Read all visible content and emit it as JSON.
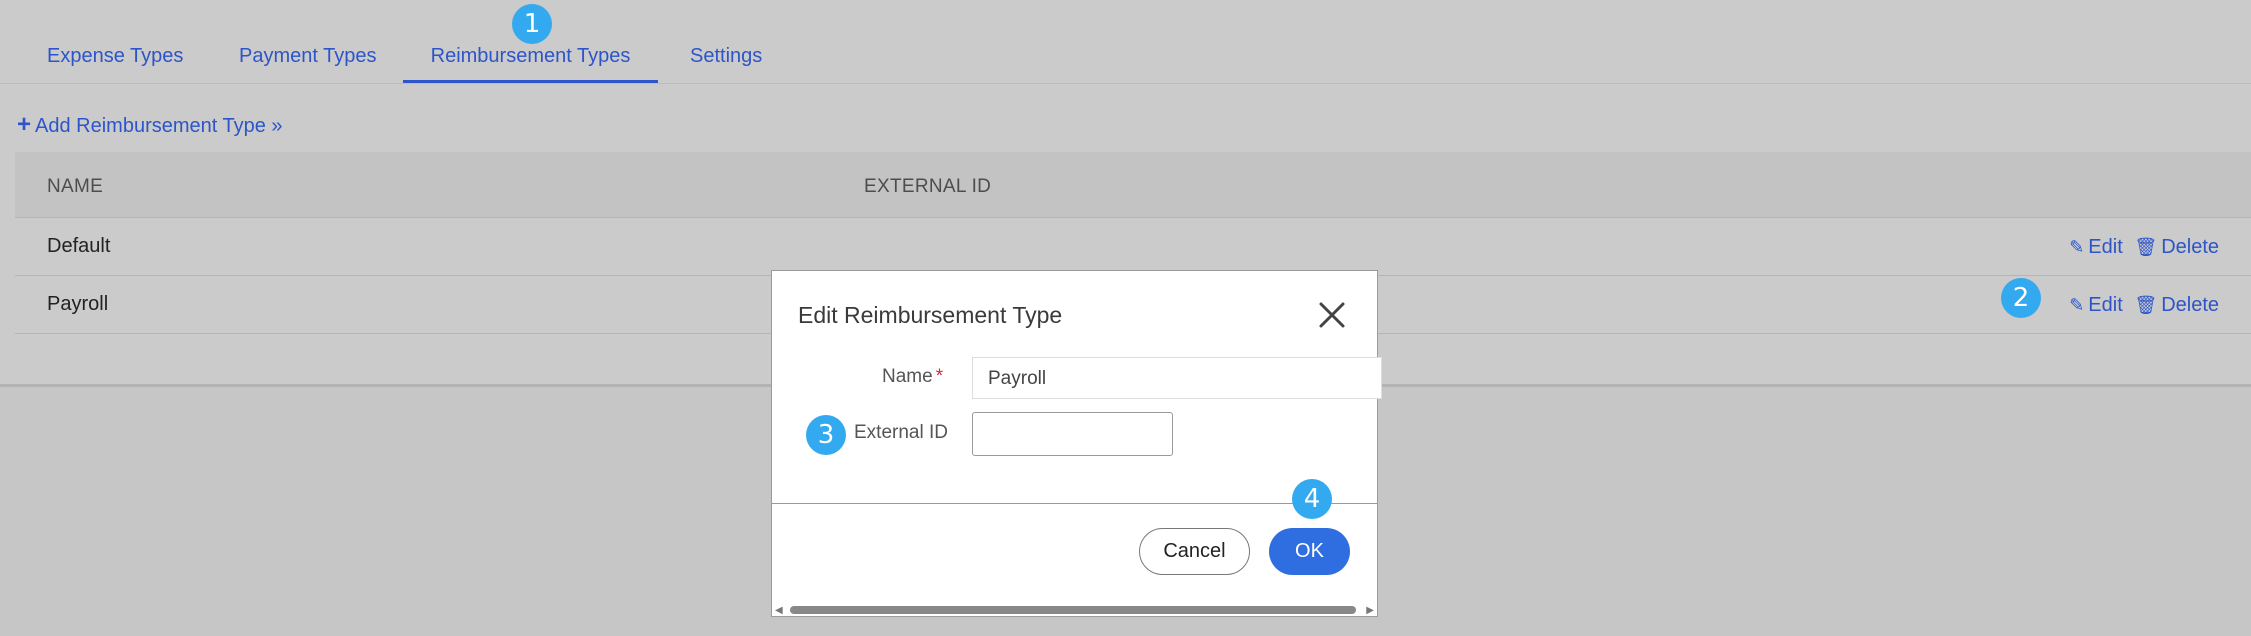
{
  "tabs": [
    {
      "label": "Expense Types"
    },
    {
      "label": "Payment Types"
    },
    {
      "label": "Reimbursement Types"
    },
    {
      "label": "Settings"
    }
  ],
  "add_link": {
    "label": "Add Reimbursement Type »"
  },
  "table": {
    "headers": [
      "NAME",
      "EXTERNAL ID"
    ],
    "rows": [
      {
        "name": "Default",
        "external_id": "",
        "edit": "Edit",
        "delete": "Delete"
      },
      {
        "name": "Payroll",
        "external_id": "",
        "edit": "Edit",
        "delete": "Delete"
      }
    ]
  },
  "modal": {
    "title": "Edit Reimbursement Type",
    "name_label": "Name",
    "required_mark": "*",
    "name_value": "Payroll",
    "external_id_label": "External ID",
    "external_id_value": "",
    "cancel_label": "Cancel",
    "ok_label": "OK"
  },
  "markers": [
    "1",
    "2",
    "3",
    "4"
  ],
  "colors": {
    "accent": "#2d55c9",
    "primary_button": "#2f6ee0",
    "marker": "#33a9ef",
    "required": "#d9263b"
  }
}
